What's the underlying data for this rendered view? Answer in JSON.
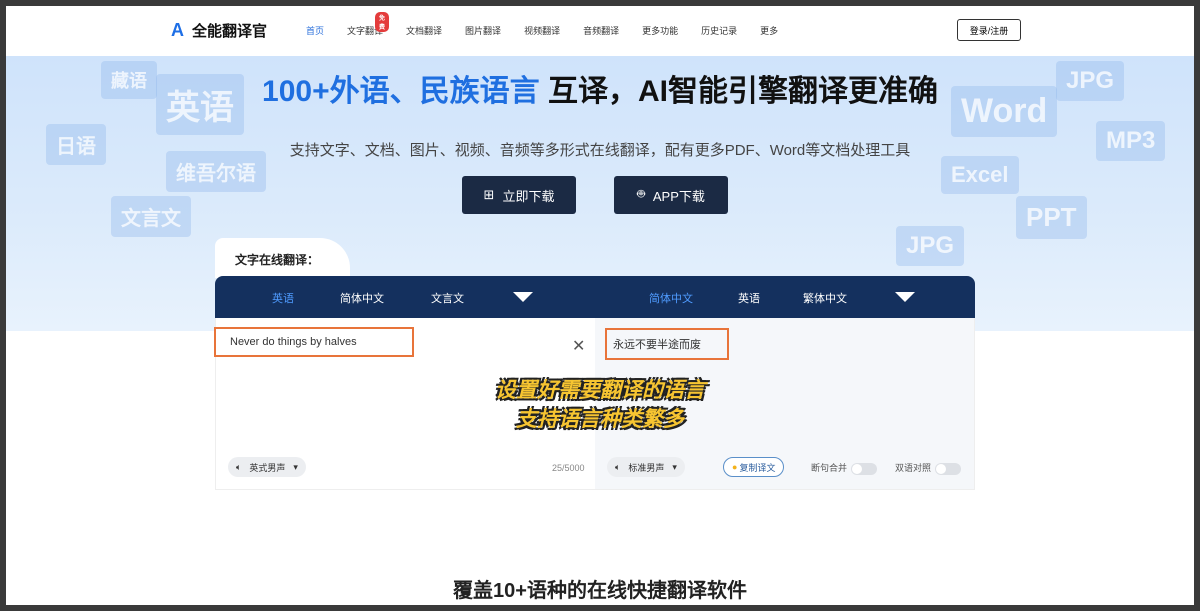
{
  "nav": {
    "logo": "全能翻译官",
    "items": [
      "首页",
      "文字翻译",
      "文档翻译",
      "图片翻译",
      "视频翻译",
      "音频翻译",
      "更多功能",
      "历史记录",
      "更多"
    ],
    "badge": "免费",
    "login": "登录/注册"
  },
  "hero": {
    "title_blue": "100+外语、民族语言",
    "title_rest": " 互译，AI智能引擎翻译更准确",
    "subtitle": "支持文字、文档、图片、视频、音频等多形式在线翻译，配有更多PDF、Word等文档处理工具",
    "download": "立即下载",
    "app": "APP下载",
    "deco": [
      "藏语",
      "英语",
      "日语",
      "维吾尔语",
      "文言文",
      "JPG",
      "Word",
      "MP3",
      "Excel",
      "PPT",
      "JPG"
    ]
  },
  "translator": {
    "tab": "文字在线翻译：",
    "source_langs": [
      "英语",
      "简体中文",
      "文言文"
    ],
    "target_langs": [
      "简体中文",
      "英语",
      "繁体中文"
    ],
    "input": "Never do things by halves",
    "output": "永远不要半途而废",
    "count": "25/5000",
    "source_voice": "英式男声",
    "target_voice": "标准男声",
    "copy": "复制译文",
    "merge": "断句合并",
    "bilingual": "双语对照"
  },
  "caption": [
    "设置好需要翻译的语言",
    "支持语言种类繁多"
  ],
  "bottom_title": "覆盖10+语种的在线快捷翻译软件",
  "colors": {
    "accent": "#1f6fe0",
    "navy": "#14305e",
    "highlight": "#e8743a",
    "caption": "#f7c531"
  }
}
